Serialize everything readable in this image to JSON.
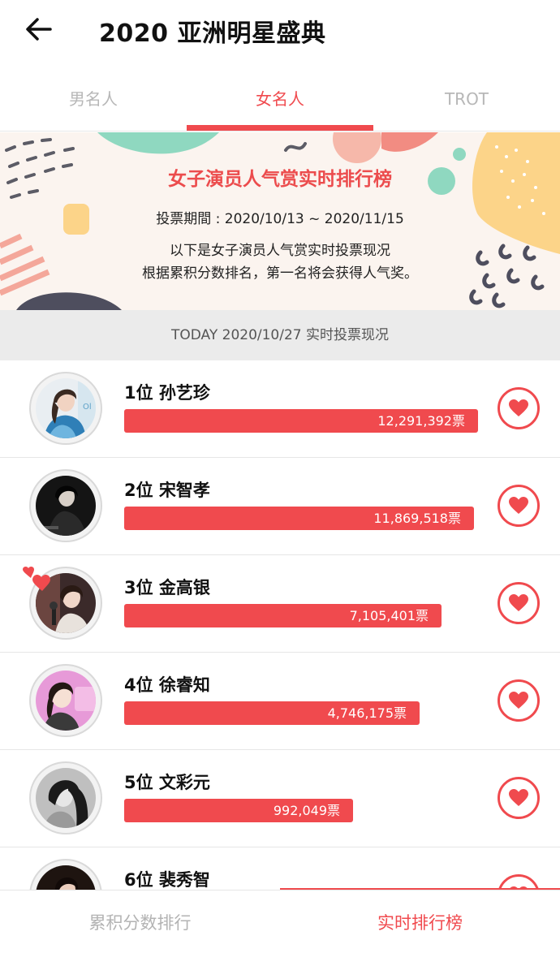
{
  "header": {
    "title": "2020 亚洲明星盛典",
    "back_icon": "arrow-left-icon"
  },
  "tabs": [
    {
      "label": "男名人",
      "active": false
    },
    {
      "label": "女名人",
      "active": true
    },
    {
      "label": "TROT",
      "active": false
    }
  ],
  "banner": {
    "title": "女子演员人气赏实时排行榜",
    "period": "投票期間 : 2020/10/13 ~ 2020/11/15",
    "desc_line1": "以下是女子演员人气赏实时投票现况",
    "desc_line2": "根据累积分数排名，第一名将会获得人气奖。"
  },
  "today": "TODAY 2020/10/27 实时投票现况",
  "accent_color": "#f04a4e",
  "ranking": [
    {
      "rank_name": "1位  孙艺珍",
      "votes": "12,291,392票",
      "vote_count": 12291392
    },
    {
      "rank_name": "2位  宋智孝",
      "votes": "11,869,518票",
      "vote_count": 11869518
    },
    {
      "rank_name": "3位  金高银",
      "votes": "7,105,401票",
      "vote_count": 7105401
    },
    {
      "rank_name": "4位  徐睿知",
      "votes": "4,746,175票",
      "vote_count": 4746175
    },
    {
      "rank_name": "5位  文彩元",
      "votes": "992,049票",
      "vote_count": 992049
    },
    {
      "rank_name": "6位  裴秀智",
      "votes": "",
      "vote_count": null
    }
  ],
  "bottom_nav": [
    {
      "label": "累积分数排行",
      "active": false
    },
    {
      "label": "实时排行榜",
      "active": true
    }
  ]
}
